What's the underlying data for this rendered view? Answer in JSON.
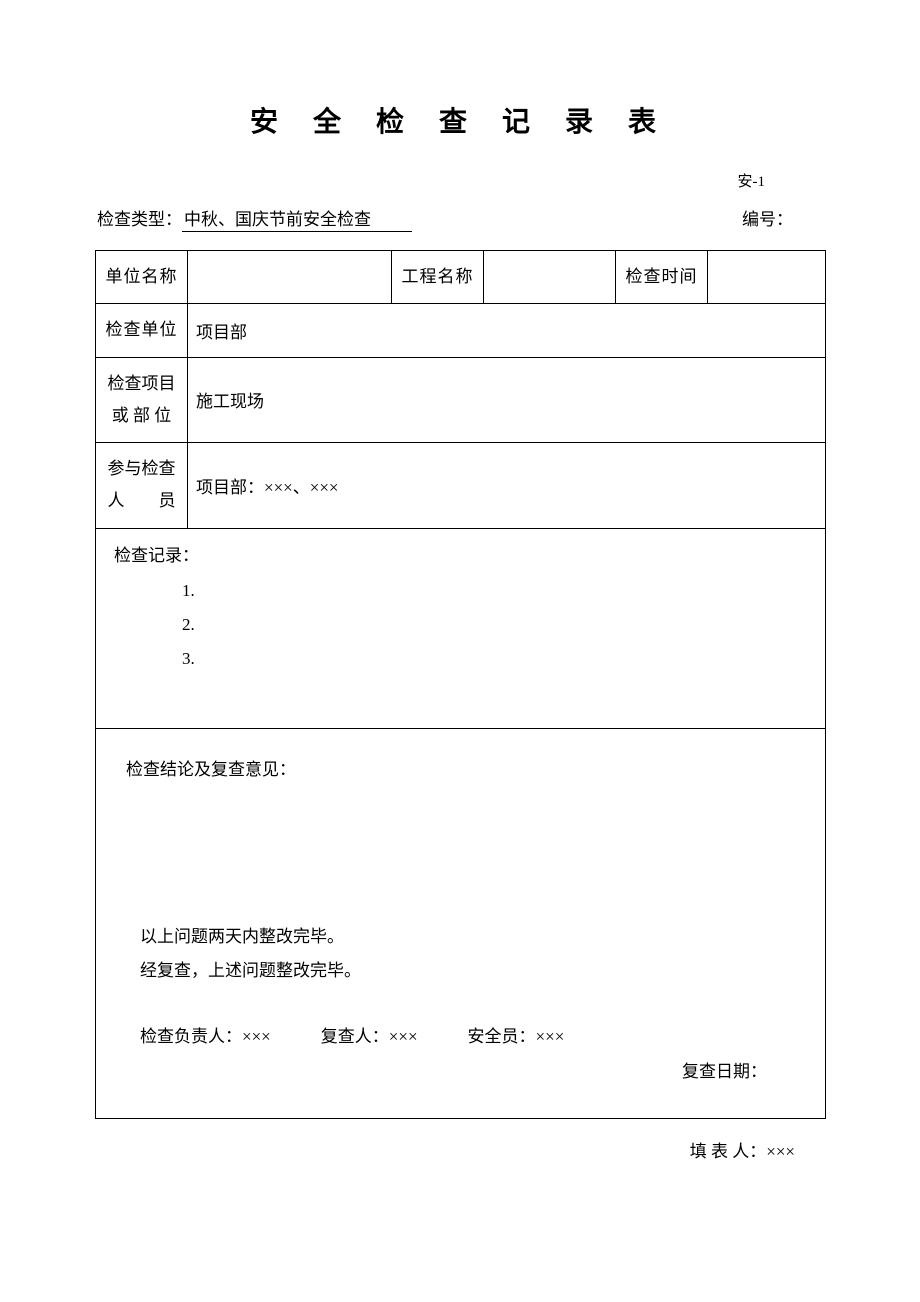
{
  "title": "安 全 检 查 记 录 表",
  "top_code": "安-1",
  "meta": {
    "type_label": "检查类型：",
    "type_value": "中秋、国庆节前安全检查",
    "serial_label": "编号："
  },
  "table": {
    "r1": {
      "unit_label": "单位名称",
      "unit_value": "",
      "project_label": "工程名称",
      "project_value": "",
      "time_label": "检查时间",
      "time_value": ""
    },
    "r2": {
      "check_unit_label": "检查单位",
      "check_unit_value": "项目部"
    },
    "r3": {
      "item_label_line1": "检查项目",
      "item_label_line2": "或 部 位",
      "item_value": "施工现场"
    },
    "r4": {
      "people_label_line1": "参与检查",
      "people_label_line2": "人　　员",
      "people_value": "项目部：×××、×××"
    },
    "records": {
      "title": "检查记录：",
      "items": [
        "1.",
        "2.",
        "3."
      ]
    },
    "conclusion": {
      "title": "检查结论及复查意见：",
      "line1": "以上问题两天内整改完毕。",
      "line2": "经复查，上述问题整改完毕。",
      "sig_check_label": "检查负责人：",
      "sig_check_value": "×××",
      "sig_recheck_label": "复查人：",
      "sig_recheck_value": "×××",
      "sig_safety_label": "安全员：",
      "sig_safety_value": "×××",
      "recheck_date_label": "复查日期："
    }
  },
  "footer": {
    "filled_label": "填 表 人：",
    "filled_value": "×××"
  }
}
